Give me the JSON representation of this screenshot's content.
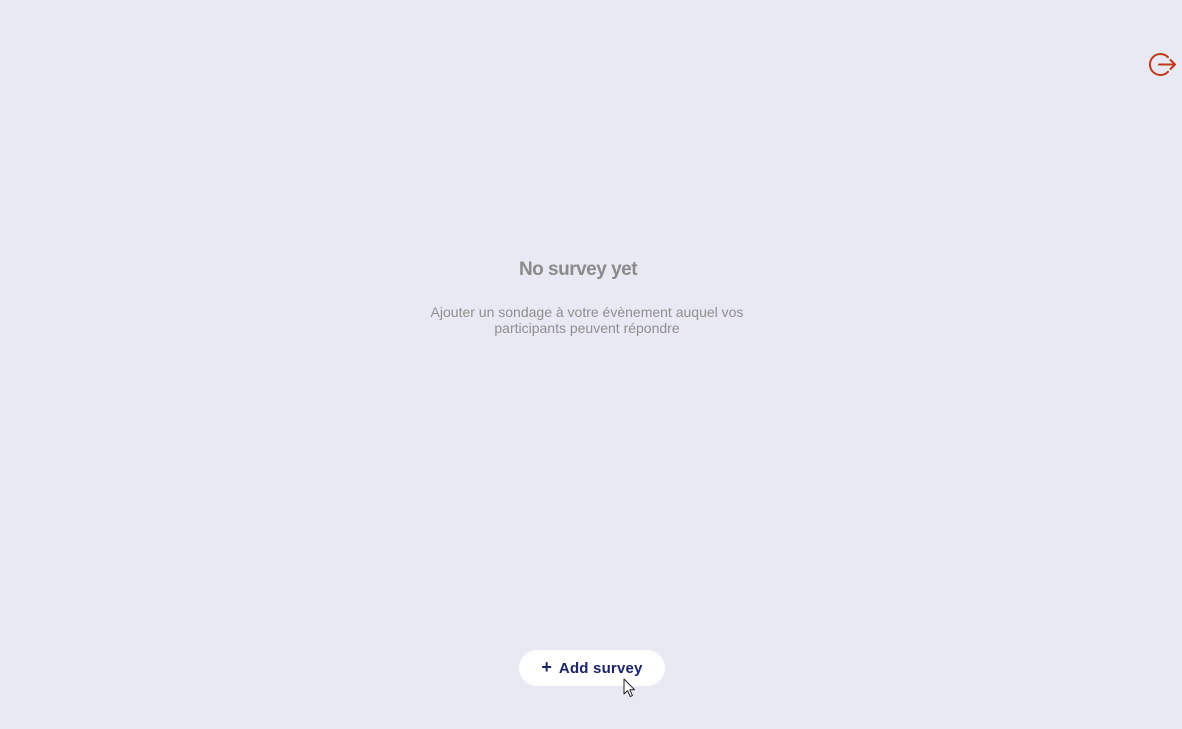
{
  "header": {
    "logout_icon": "logout-icon",
    "logout_color": "#c0391b"
  },
  "empty_state": {
    "title": "No survey yet",
    "description": "Ajouter un sondage à votre évènement auquel vos participants peuvent répondre"
  },
  "actions": {
    "add_icon": "+",
    "add_label": "Add survey"
  },
  "colors": {
    "background": "#e9e9f4",
    "button_text": "#1b2566",
    "muted_text": "#8b8b8b"
  }
}
